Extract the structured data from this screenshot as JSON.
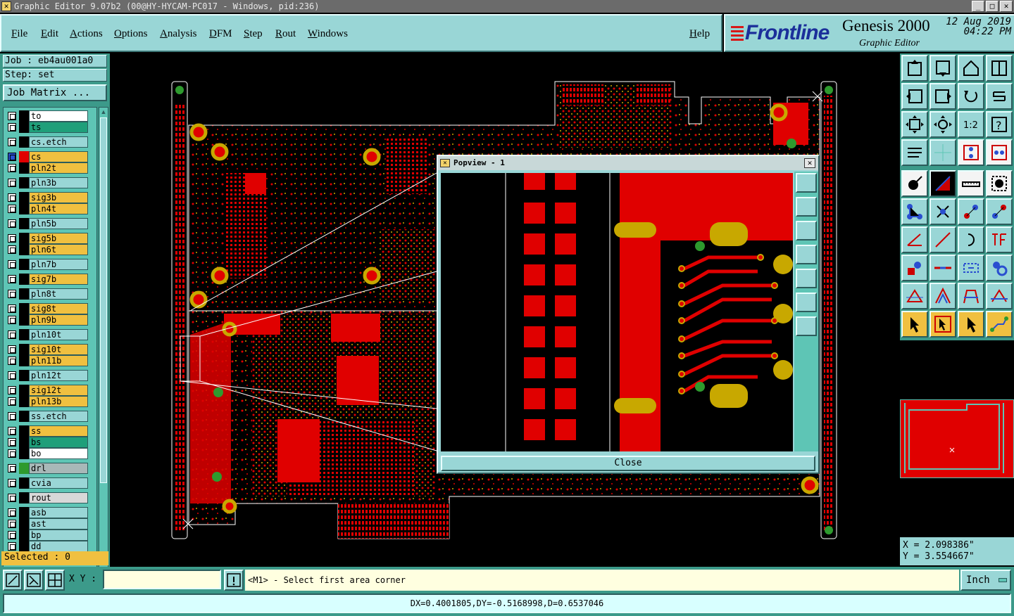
{
  "window": {
    "title": "Graphic Editor 9.07b2 (00@HY-HYCAM-PC017 - Windows, pid:236)"
  },
  "menu": [
    {
      "label": "File"
    },
    {
      "label": "Edit"
    },
    {
      "label": "Actions"
    },
    {
      "label": "Options"
    },
    {
      "label": "Analysis"
    },
    {
      "label": "DFM"
    },
    {
      "label": "Step"
    },
    {
      "label": "Rout"
    },
    {
      "label": "Windows"
    }
  ],
  "help_label": "Help",
  "brand": {
    "company": "Frontline",
    "product": "Genesis 2000",
    "subtitle": "Graphic Editor",
    "date": "12 Aug 2019",
    "time": "04:22 PM"
  },
  "job": {
    "job_text": "Job : eb4au001a0",
    "step_text": "Step: set",
    "matrix_label": "Job Matrix ..."
  },
  "layers": [
    {
      "name": "to",
      "color": "#ffffff",
      "swatch": "#000000"
    },
    {
      "name": "ts",
      "color": "#1f9f7a",
      "swatch": "#000000"
    },
    {
      "name": "cs.etch",
      "color": "#99d6d6",
      "swatch": "#000000"
    },
    {
      "name": "cs",
      "color": "#f0c040",
      "swatch": "#e00000",
      "active": true
    },
    {
      "name": "pln2t",
      "color": "#f0c040",
      "swatch": "#000000"
    },
    {
      "name": "pln3b",
      "color": "#99d6d6",
      "swatch": "#000000"
    },
    {
      "name": "sig3b",
      "color": "#f0c040",
      "swatch": "#000000"
    },
    {
      "name": "pln4t",
      "color": "#f0c040",
      "swatch": "#000000"
    },
    {
      "name": "pln5b",
      "color": "#99d6d6",
      "swatch": "#000000"
    },
    {
      "name": "sig5b",
      "color": "#f0c040",
      "swatch": "#000000"
    },
    {
      "name": "pln6t",
      "color": "#f0c040",
      "swatch": "#000000"
    },
    {
      "name": "pln7b",
      "color": "#99d6d6",
      "swatch": "#000000"
    },
    {
      "name": "sig7b",
      "color": "#f0c040",
      "swatch": "#000000"
    },
    {
      "name": "pln8t",
      "color": "#99d6d6",
      "swatch": "#000000"
    },
    {
      "name": "sig8t",
      "color": "#f0c040",
      "swatch": "#000000"
    },
    {
      "name": "pln9b",
      "color": "#f0c040",
      "swatch": "#000000"
    },
    {
      "name": "pln10t",
      "color": "#99d6d6",
      "swatch": "#000000"
    },
    {
      "name": "sig10t",
      "color": "#f0c040",
      "swatch": "#000000"
    },
    {
      "name": "pln11b",
      "color": "#f0c040",
      "swatch": "#000000"
    },
    {
      "name": "pln12t",
      "color": "#99d6d6",
      "swatch": "#000000"
    },
    {
      "name": "sig12t",
      "color": "#f0c040",
      "swatch": "#000000"
    },
    {
      "name": "pln13b",
      "color": "#f0c040",
      "swatch": "#000000"
    },
    {
      "name": "ss.etch",
      "color": "#99d6d6",
      "swatch": "#000000"
    },
    {
      "name": "ss",
      "color": "#f0c040",
      "swatch": "#000000"
    },
    {
      "name": "bs",
      "color": "#1f9f7a",
      "swatch": "#000000"
    },
    {
      "name": "bo",
      "color": "#ffffff",
      "swatch": "#000000"
    },
    {
      "name": "drl",
      "color": "#a8b8b8",
      "swatch": "#2e9a2e"
    },
    {
      "name": "cvia",
      "color": "#99d6d6",
      "swatch": "#000000"
    },
    {
      "name": "rout",
      "color": "#d8d8d8",
      "swatch": "#000000"
    },
    {
      "name": "asb",
      "color": "#99d6d6",
      "swatch": "#000000"
    },
    {
      "name": "ast",
      "color": "#99d6d6",
      "swatch": "#000000"
    },
    {
      "name": "bp",
      "color": "#99d6d6",
      "swatch": "#000000"
    },
    {
      "name": "dd",
      "color": "#99d6d6",
      "swatch": "#000000"
    }
  ],
  "selected_text": "Selected : 0",
  "popview": {
    "title": "Popview - 1",
    "close_label": "Close"
  },
  "coords": {
    "x_text": "X = 2.098386\"",
    "y_text": "Y = 3.554667\""
  },
  "bottom": {
    "xy_label": "X Y :",
    "xy_value": "",
    "prompt": "<M1> - Select first area corner",
    "unit": "Inch",
    "status": "DX=0.4001805,DY=-0.5168998,D=0.6537046"
  },
  "colors": {
    "copper": "#e00000",
    "pad_yellow": "#c8a800",
    "drill_green": "#2e9a2e",
    "panel": "#99d6d6",
    "panel_dark": "#3c9a8a"
  }
}
